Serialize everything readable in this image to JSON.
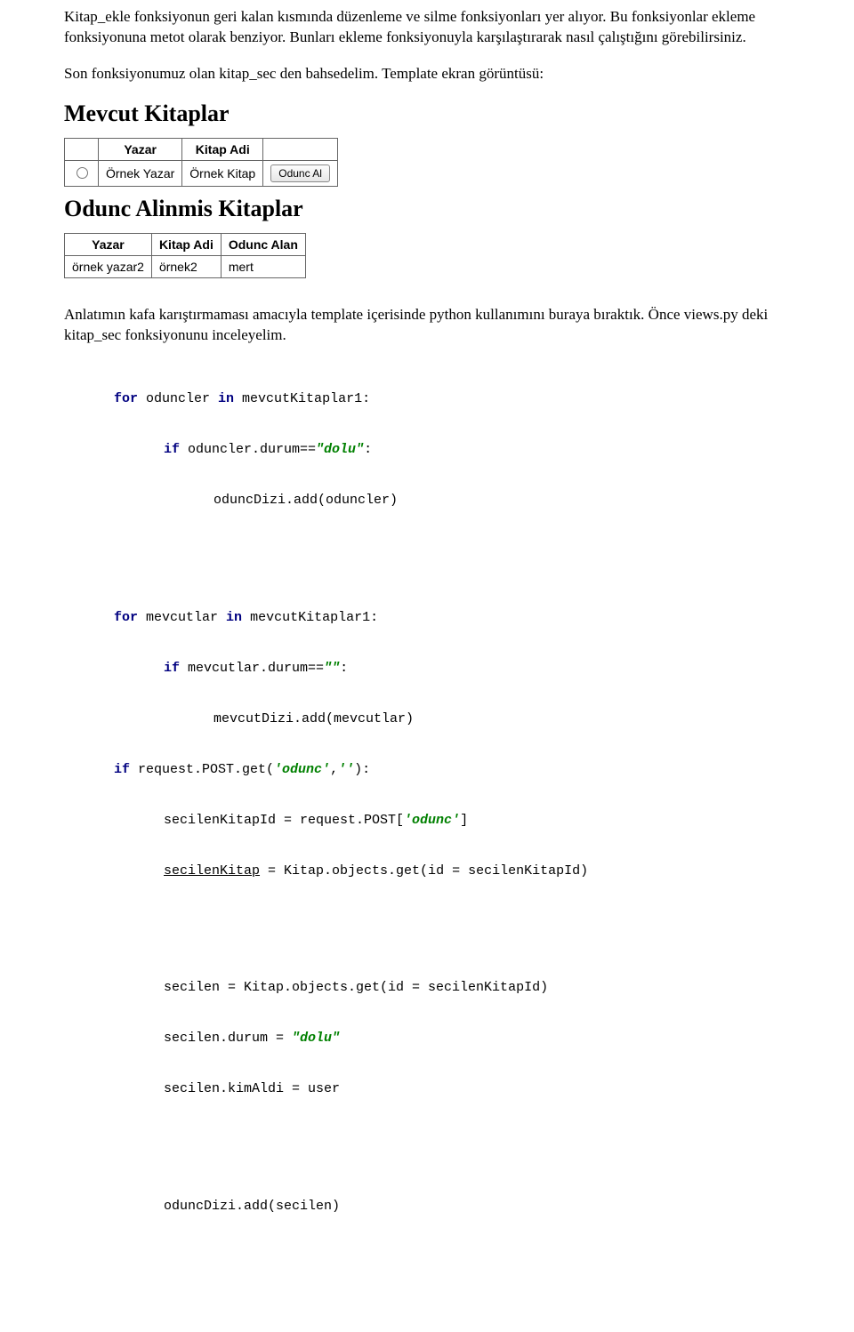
{
  "paragraphs": {
    "p1": "Kitap_ekle fonksiyonun geri kalan kısmında düzenleme ve silme fonksiyonları yer alıyor. Bu fonksiyonlar ekleme fonksiyonuna metot olarak benziyor. Bunları ekleme fonksiyonuyla karşılaştırarak nasıl çalıştığını görebilirsiniz.",
    "p2": "Son fonksiyonumuz olan kitap_sec den bahsedelim. Template ekran görüntüsü:",
    "p3": "Anlatımın kafa karıştırmaması amacıyla template içerisinde python kullanımını buraya bıraktık. Önce views.py deki kitap_sec fonksiyonunu inceleyelim."
  },
  "screenshot": {
    "heading1": "Mevcut Kitaplar",
    "table1": {
      "headers": {
        "col0": "",
        "col1": "Yazar",
        "col2": "Kitap Adi"
      },
      "row": {
        "c0": "",
        "c1": "Örnek Yazar",
        "c2": "Örnek Kitap",
        "button": "Odunc Al"
      }
    },
    "heading2": "Odunc Alinmis Kitaplar",
    "table2": {
      "headers": {
        "col1": "Yazar",
        "col2": "Kitap Adi",
        "col3": "Odunc Alan"
      },
      "row": {
        "c1": "örnek yazar2",
        "c2": "örnek2",
        "c3": "mert"
      }
    }
  },
  "code": {
    "l1a": "for",
    "l1b": " oduncler ",
    "l1c": "in",
    "l1d": " mevcutKitaplar1:",
    "l2a": "if",
    "l2b": " oduncler.durum==",
    "l2c": "\"dolu\"",
    "l2d": ":",
    "l3": "oduncDizi.add(oduncler)",
    "l4a": "for",
    "l4b": " mevcutlar ",
    "l4c": "in",
    "l4d": " mevcutKitaplar1:",
    "l5a": "if",
    "l5b": " mevcutlar.durum==",
    "l5c": "\"\"",
    "l5d": ":",
    "l6": "mevcutDizi.add(mevcutlar)",
    "l7a": "if",
    "l7b": " request.POST.get(",
    "l7c": "'odunc'",
    "l7d": ",",
    "l7e": "''",
    "l7f": "):",
    "l8a": "secilenKitapId = request.POST[",
    "l8b": "'odunc'",
    "l8c": "]",
    "l9a": "secilenKitap",
    "l9b": " = Kitap.objects.get(id = secilenKitapId)",
    "l10": "secilen = Kitap.objects.get(id = secilenKitapId)",
    "l11a": "secilen.durum = ",
    "l11b": "\"dolu\"",
    "l12": "secilen.kimAldi = user",
    "l13": "oduncDizi.add(secilen)"
  }
}
